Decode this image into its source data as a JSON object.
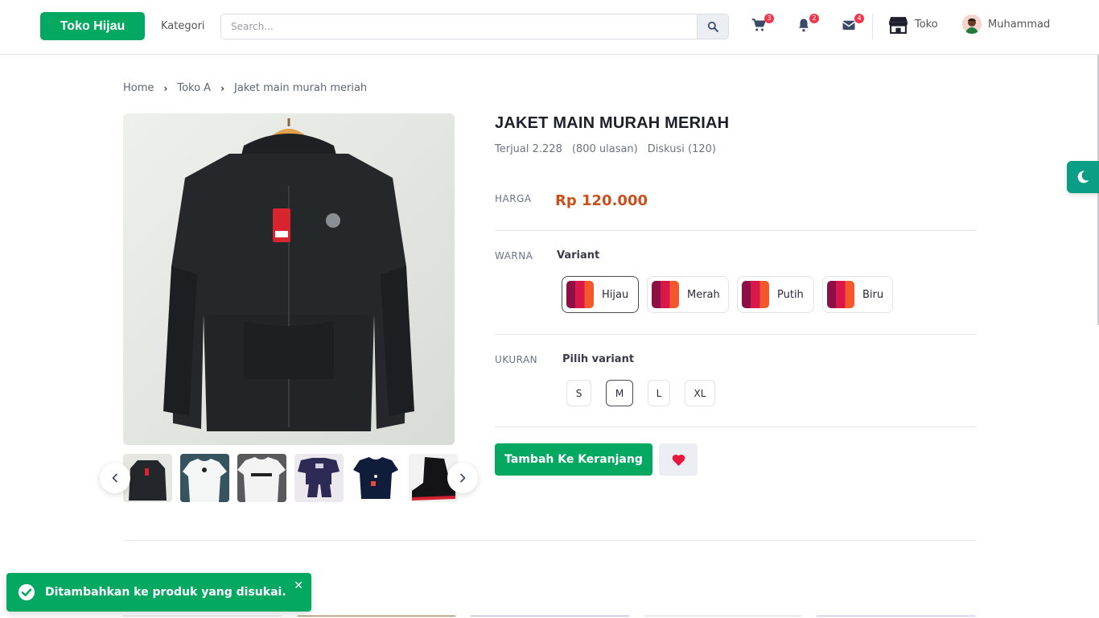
{
  "navbar": {
    "brand": "Toko Hijau",
    "kategori": "Kategori",
    "search_placeholder": "Search...",
    "cart_count": "3",
    "notif_count": "2",
    "mail_count": "4",
    "toko_label": "Toko",
    "user_name": "Muhammad"
  },
  "breadcrumb": {
    "items": [
      "Home",
      "Toko A",
      "Jaket main murah meriah"
    ]
  },
  "product": {
    "title": "JAKET MAIN MURAH MERIAH",
    "sold": "Terjual 2.228",
    "reviews": "(800 ulasan)",
    "discussion": "Diskusi (120)",
    "price_label": "HARGA",
    "price": "Rp 120.000",
    "price_color": "#c9501c",
    "color_label": "WARNA",
    "color_sub": "Variant",
    "colors": [
      "Hijau",
      "Merah",
      "Putih",
      "Biru"
    ],
    "selected_color": "Hijau",
    "size_label": "UKURAN",
    "size_sub": "Pilih variant",
    "sizes": [
      "S",
      "M",
      "L",
      "XL"
    ],
    "selected_size": "M",
    "add_to_cart": "Tambah Ke Keranjang"
  },
  "toast": {
    "message": "Ditambahkan ke produk yang disukai."
  },
  "colors": {
    "accent": "#04a861",
    "badge": "#f0384d",
    "theme_toggle": "#0a9e86",
    "wishlist_heart": "#e8173d"
  },
  "icons": [
    "search-icon",
    "cart-icon",
    "bell-icon",
    "mail-icon",
    "store-icon",
    "chevron-left-icon",
    "chevron-right-icon",
    "heart-icon",
    "moon-icon",
    "check-circle-icon",
    "close-icon"
  ]
}
